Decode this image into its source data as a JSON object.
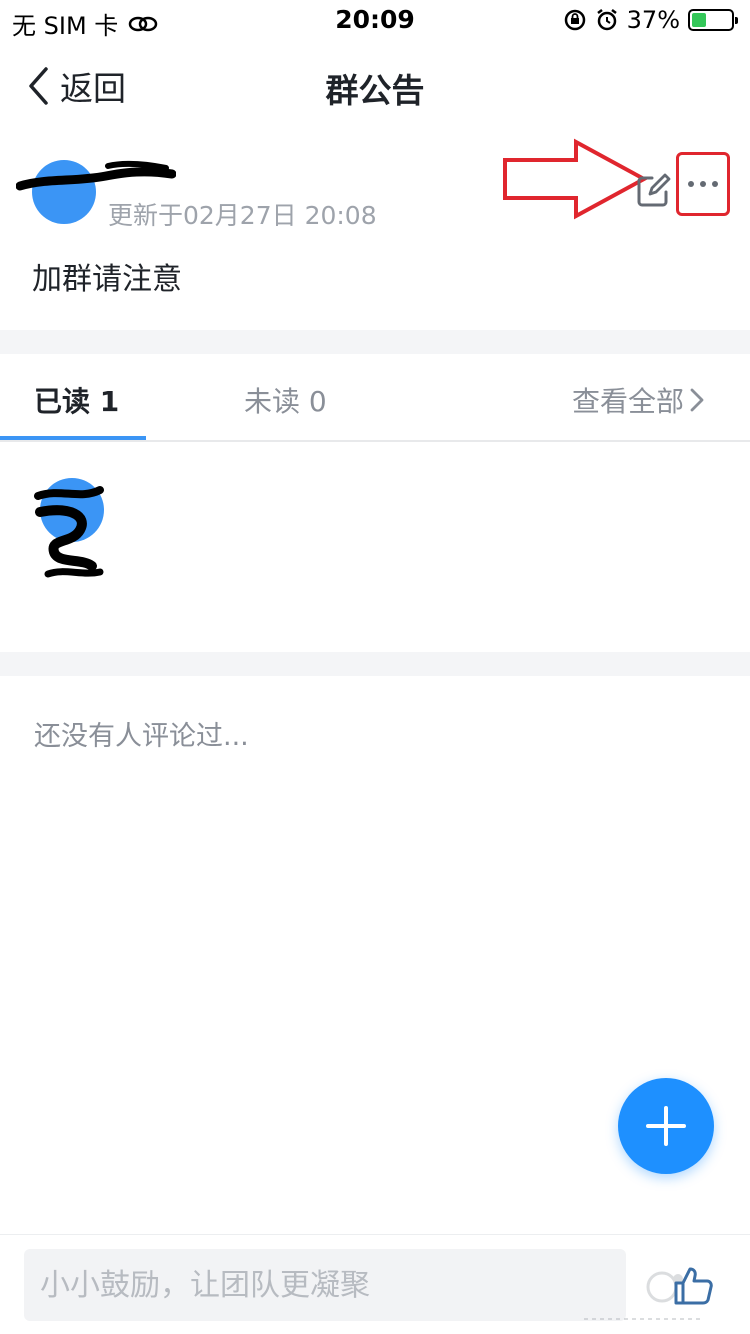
{
  "status_bar": {
    "carrier": "无 SIM 卡",
    "time": "20:09",
    "battery_percent": "37%",
    "battery_level": 0.37
  },
  "navbar": {
    "back_label": "返回",
    "title": "群公告"
  },
  "announcement": {
    "update_time": "更新于02月27日 20:08",
    "content": "加群请注意"
  },
  "tabs": {
    "read_label": "已读 1",
    "unread_label": "未读 0",
    "view_all_label": "查看全部"
  },
  "comments": {
    "empty_text": "还没有人评论过..."
  },
  "bottom": {
    "input_placeholder": "小小鼓励，让团队更凝聚"
  },
  "colors": {
    "accent": "#1e90ff",
    "annotation_red": "#e0262e"
  }
}
